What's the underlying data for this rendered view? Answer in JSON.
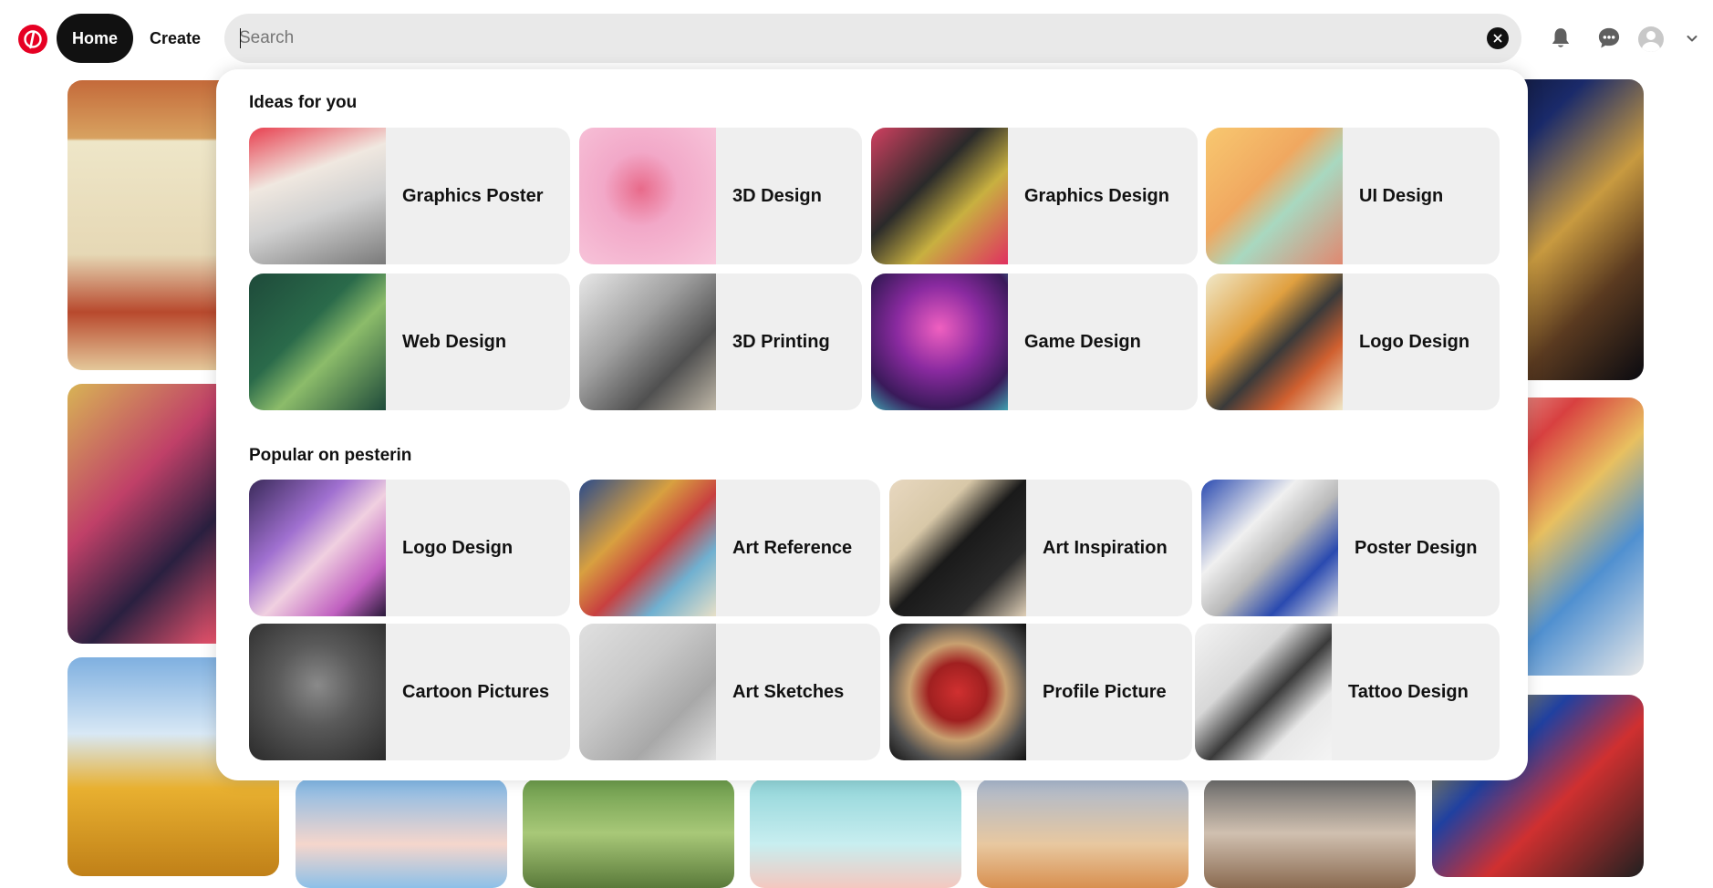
{
  "header": {
    "home_label": "Home",
    "create_label": "Create",
    "search_placeholder": "Search",
    "search_value": "",
    "icons": [
      "pinterest-logo-icon",
      "close-icon",
      "bell-icon",
      "chat-icon",
      "avatar",
      "chevron-down-icon"
    ]
  },
  "dropdown": {
    "ideas_title": "Ideas for you",
    "ideas": [
      {
        "label": "Graphics Poster"
      },
      {
        "label": "3D Design"
      },
      {
        "label": "Graphics Design"
      },
      {
        "label": "UI Design"
      },
      {
        "label": "Web Design"
      },
      {
        "label": "3D Printing"
      },
      {
        "label": "Game Design"
      },
      {
        "label": "Logo Design"
      }
    ],
    "popular_title": "Popular on pesterin",
    "popular": [
      {
        "label": "Logo Design"
      },
      {
        "label": "Art Reference"
      },
      {
        "label": "Art Inspiration"
      },
      {
        "label": "Poster Design"
      },
      {
        "label": "Cartoon Pictures"
      },
      {
        "label": "Art Sketches"
      },
      {
        "label": "Profile Picture"
      },
      {
        "label": "Tattoo Design"
      }
    ]
  },
  "colors": {
    "brand": "#e60023",
    "active_nav": "#111111",
    "search_bg": "#e9e9e9",
    "card_bg": "#efefef"
  }
}
